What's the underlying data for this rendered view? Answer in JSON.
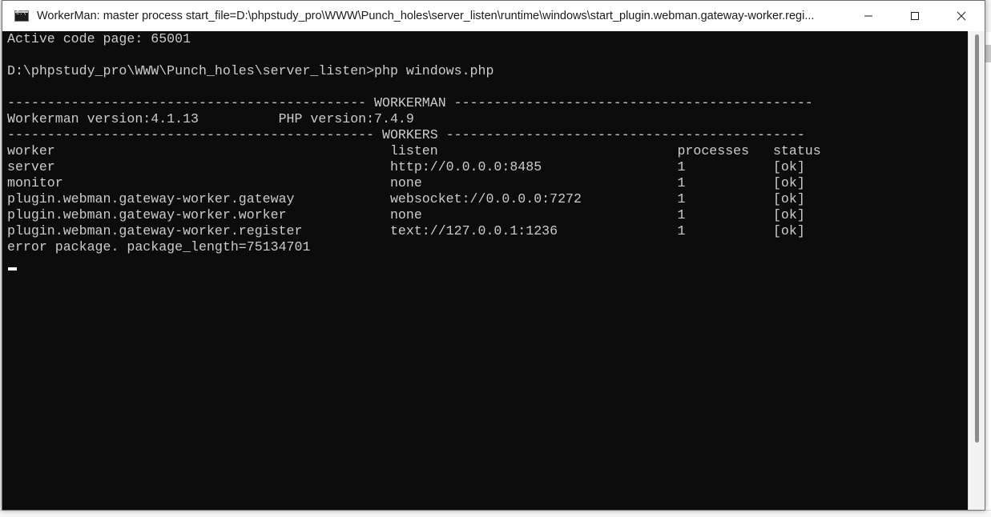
{
  "window": {
    "title": "WorkerMan: master process  start_file=D:\\phpstudy_pro\\WWW\\Punch_holes\\server_listen\\runtime\\windows\\start_plugin.webman.gateway-worker.regi...",
    "controls": {
      "minimize": "minimize-icon",
      "maximize": "maximize-icon",
      "close": "close-icon"
    }
  },
  "console": {
    "lines": [
      "Active code page: 65001",
      "",
      "D:\\phpstudy_pro\\WWW\\Punch_holes\\server_listen>php windows.php",
      "",
      "--------------------------------------------- WORKERMAN ---------------------------------------------",
      "Workerman version:4.1.13          PHP version:7.4.9",
      "---------------------------------------------- WORKERS ---------------------------------------------",
      "worker                                          listen                              processes   status",
      "server                                          http://0.0.0.0:8485                 1           [ok]",
      "monitor                                         none                                1           [ok]",
      "plugin.webman.gateway-worker.gateway            websocket://0.0.0.0:7272            1           [ok]",
      "plugin.webman.gateway-worker.worker             none                                1           [ok]",
      "plugin.webman.gateway-worker.register           text://127.0.0.1:1236               1           [ok]",
      "error package. package_length=75134701"
    ]
  },
  "colors": {
    "console_bg": "#0c0c0c",
    "console_text": "#cccccc",
    "titlebar_bg": "#ffffff"
  }
}
